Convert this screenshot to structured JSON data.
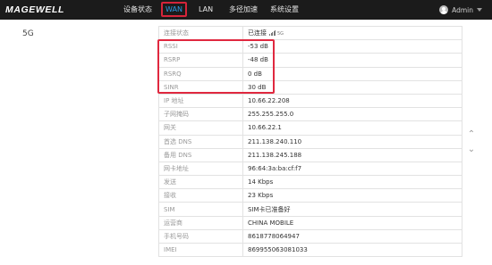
{
  "header": {
    "logo": "MAGEWELL",
    "nav": [
      {
        "label": "设备状态"
      },
      {
        "label": "WAN"
      },
      {
        "label": "LAN"
      },
      {
        "label": "多径加速"
      },
      {
        "label": "系统设置"
      }
    ],
    "user": "Admin"
  },
  "section": {
    "label": "5G"
  },
  "table": {
    "rows": [
      {
        "key": "连接状态",
        "value": "已连接"
      },
      {
        "key": "RSSI",
        "value": "-53 dB"
      },
      {
        "key": "RSRP",
        "value": "-48 dB"
      },
      {
        "key": "RSRQ",
        "value": "0 dB"
      },
      {
        "key": "SINR",
        "value": "30 dB"
      },
      {
        "key": "IP 地址",
        "value": "10.66.22.208"
      },
      {
        "key": "子网掩码",
        "value": "255.255.255.0"
      },
      {
        "key": "网关",
        "value": "10.66.22.1"
      },
      {
        "key": "首选 DNS",
        "value": "211.138.240.110"
      },
      {
        "key": "备用 DNS",
        "value": "211.138.245.188"
      },
      {
        "key": "网卡地址",
        "value": "96:64:3a:ba:cf:f7"
      },
      {
        "key": "发送",
        "value": "14 Kbps"
      },
      {
        "key": "接收",
        "value": "23 Kbps"
      },
      {
        "key": "SIM",
        "value": "SIM卡已准备好"
      },
      {
        "key": "运营商",
        "value": "CHINA MOBILE"
      },
      {
        "key": "手机号码",
        "value": "8618778064947"
      },
      {
        "key": "IMEI",
        "value": "869955063081033"
      }
    ],
    "signal_badge": "5G"
  },
  "icons": {
    "user": "user-avatar-icon",
    "caret": "chevron-down-icon",
    "signal": "signal-bars-icon",
    "scroll_up": "chevron-up-icon",
    "scroll_down": "chevron-down-icon"
  },
  "colors": {
    "topbar": "#1b1b1b",
    "active_tab_text": "#2e9be6",
    "highlight": "#e0283f"
  }
}
